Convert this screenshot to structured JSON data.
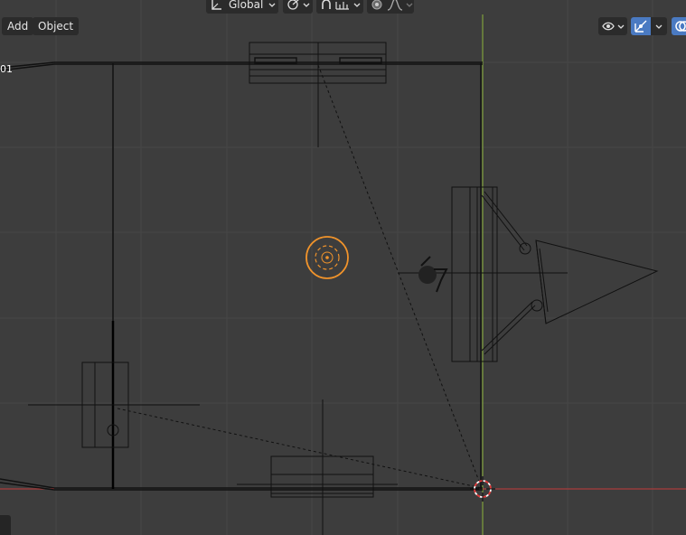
{
  "header": {
    "add_label": "Add",
    "object_label": "Object",
    "orientation_label": "Global"
  },
  "viewport": {
    "collection_suffix": "01"
  },
  "colors": {
    "background": "#3d3d3d",
    "grid_minor": "#454545",
    "grid_major": "#4e4e4e",
    "x_axis": "#c23a3a",
    "y_axis": "#8bb23a",
    "selection": "#f0932b",
    "active_blue": "#4a7ac2",
    "header_button": "#2b2b2b"
  }
}
